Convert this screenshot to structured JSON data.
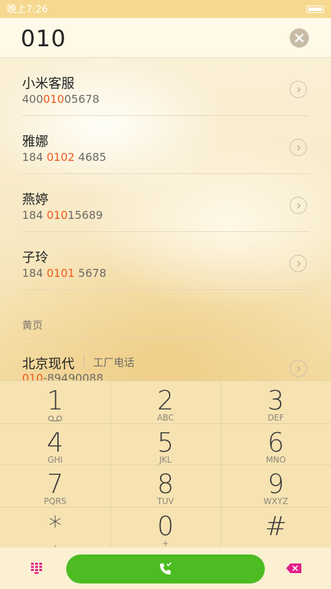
{
  "status_bar": {
    "time": "晚上7:26"
  },
  "search": {
    "query": "010"
  },
  "contacts": [
    {
      "name": "小米客服",
      "number_pre": "400",
      "number_match": "010",
      "number_post": "05678"
    },
    {
      "name": "雅娜",
      "number_pre": "184 ",
      "number_match": "0102",
      "number_post": " 4685"
    },
    {
      "name": "燕婷",
      "number_pre": "184 ",
      "number_match": "010",
      "number_post": "15689"
    },
    {
      "name": "子玲",
      "number_pre": "184 ",
      "number_match": "0101",
      "number_post": " 5678"
    }
  ],
  "yellow_pages": {
    "header": "黄页",
    "name": "北京现代",
    "tag": "工厂电话",
    "number_match": "010",
    "number_post": "-89490088"
  },
  "keypad": {
    "keys": [
      {
        "digit": "1",
        "letters": ""
      },
      {
        "digit": "2",
        "letters": "ABC"
      },
      {
        "digit": "3",
        "letters": "DEF"
      },
      {
        "digit": "4",
        "letters": "GHI"
      },
      {
        "digit": "5",
        "letters": "JKL"
      },
      {
        "digit": "6",
        "letters": "MNO"
      },
      {
        "digit": "7",
        "letters": "PQRS"
      },
      {
        "digit": "8",
        "letters": "TUV"
      },
      {
        "digit": "9",
        "letters": "WXYZ"
      },
      {
        "digit": "*",
        "letters": ","
      },
      {
        "digit": "0",
        "letters": "+"
      },
      {
        "digit": "#",
        "letters": ""
      }
    ]
  },
  "colors": {
    "accent_match": "#ef5a20",
    "call_button": "#4cbc22",
    "keypad_bg": "#f7e3b2",
    "backspace": "#e0208a",
    "grid_icon": "#e0208a"
  },
  "icons": {
    "clear": "clear-circle-icon",
    "chevron": "chevron-right-circle-icon",
    "voicemail": "voicemail-icon",
    "grid": "grid-keypad-icon",
    "call": "phone-icon",
    "backspace": "backspace-icon"
  }
}
